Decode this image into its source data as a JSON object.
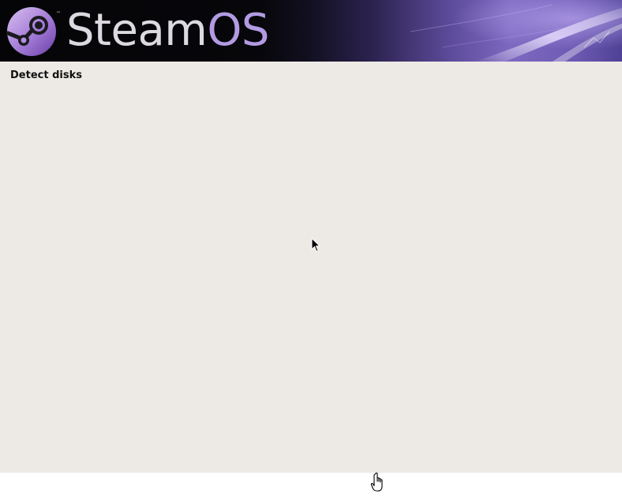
{
  "banner": {
    "brand_part1": "Steam",
    "brand_part2": "OS",
    "trademark": "™",
    "logo": "steam-logo-icon",
    "colors": {
      "logo_gradient_light": "#c9a6e6",
      "logo_gradient_dark": "#7e4fb8",
      "wordmark_steam": "#dcd9e0",
      "wordmark_os": "#b39be3",
      "banner_accent": "#7d69c0"
    }
  },
  "step": {
    "title": "Detect disks"
  },
  "colors": {
    "window_background": "#edeae5",
    "desktop_background": "#ffffff"
  },
  "cursors": {
    "pointer": "arrow-cursor-icon",
    "hand": "hand-cursor-icon"
  }
}
